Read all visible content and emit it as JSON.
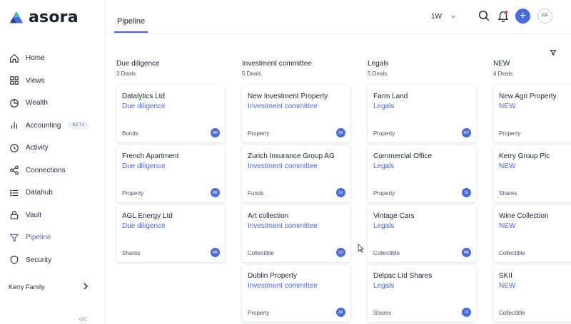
{
  "app": {
    "name": "asora",
    "brand_color": "#4a6ae0"
  },
  "sidebar": {
    "items": [
      {
        "label": "Home",
        "icon": "home-icon"
      },
      {
        "label": "Views",
        "icon": "grid-icon"
      },
      {
        "label": "Wealth",
        "icon": "pie-chart-icon"
      },
      {
        "label": "Accounting",
        "icon": "bar-chart-icon",
        "badge": "BETA"
      },
      {
        "label": "Activity",
        "icon": "clock-icon"
      },
      {
        "label": "Connections",
        "icon": "share-icon"
      },
      {
        "label": "Datahub",
        "icon": "list-icon"
      },
      {
        "label": "Vault",
        "icon": "lock-icon"
      },
      {
        "label": "Pipeline",
        "icon": "funnel-icon",
        "active": true
      },
      {
        "label": "Security",
        "icon": "shield-icon"
      }
    ],
    "family": "Kerry Family",
    "collapse_label": "<<"
  },
  "header": {
    "tab": "Pipeline",
    "period": "1W",
    "user_initials": "FP",
    "add_label": "+"
  },
  "columns": [
    {
      "title": "Due diligence",
      "count": "3 Deals",
      "cards": [
        {
          "name": "Datalytics Ltd",
          "stage": "Due diligence",
          "type": "Bonds",
          "owner": "MK"
        },
        {
          "name": "French Apartment",
          "stage": "Due diligence",
          "type": "Property",
          "owner": "MK"
        },
        {
          "name": "AGL Energy Ltd",
          "stage": "Due diligence",
          "type": "Shares",
          "owner": "MK"
        }
      ]
    },
    {
      "title": "Investment committee",
      "count": "5 Deals",
      "cards": [
        {
          "name": "New Investment Property",
          "stage": "Investment committee",
          "type": "Property",
          "owner": "SK"
        },
        {
          "name": "Zurich Insurance Group AG",
          "stage": "Investment committee",
          "type": "Funds",
          "owner": "LK"
        },
        {
          "name": "Art collection",
          "stage": "Investment committee",
          "type": "Collectible",
          "owner": "SO"
        },
        {
          "name": "Dublin Property",
          "stage": "Investment committee",
          "type": "Property",
          "owner": "AK"
        }
      ]
    },
    {
      "title": "Legals",
      "count": "5 Deals",
      "cards": [
        {
          "name": "Farm Land",
          "stage": "Legals",
          "type": "Property",
          "owner": "KP"
        },
        {
          "name": "Commercial Office",
          "stage": "Legals",
          "type": "Property",
          "owner": "SL"
        },
        {
          "name": "Vintage Cars",
          "stage": "Legals",
          "type": "Collectible",
          "owner": "MK"
        },
        {
          "name": "Delpac Ltd Shares",
          "stage": "Legals",
          "type": "Shares",
          "owner": "LK"
        }
      ]
    },
    {
      "title": "NEW",
      "count": "4 Deals",
      "cards": [
        {
          "name": "New Agri Property",
          "stage": "NEW",
          "type": "Property",
          "owner": ""
        },
        {
          "name": "Kerry Group Plc",
          "stage": "NEW",
          "type": "Shares",
          "owner": ""
        },
        {
          "name": "Wine Collection",
          "stage": "NEW",
          "type": "Collectible",
          "owner": ""
        },
        {
          "name": "SKII",
          "stage": "NEW",
          "type": "Collectible",
          "owner": ""
        }
      ]
    }
  ]
}
